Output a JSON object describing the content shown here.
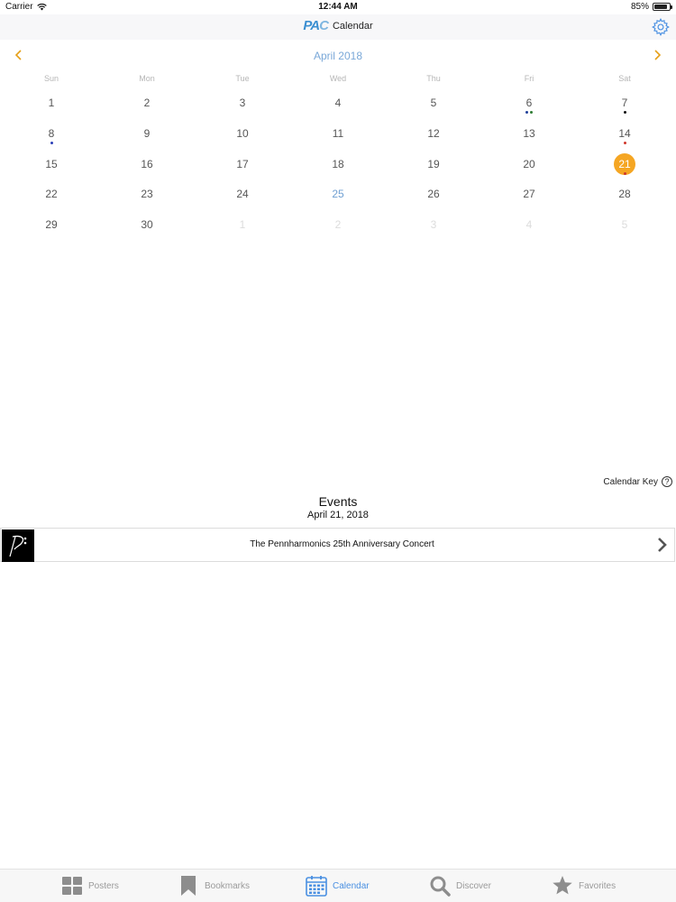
{
  "status_bar": {
    "carrier": "Carrier",
    "time": "12:44 AM",
    "battery": "85%",
    "battery_level": 0.85
  },
  "nav": {
    "title": "Calendar",
    "logo_a": "PA",
    "logo_b": "C"
  },
  "calendar": {
    "month": "April 2018",
    "weekdays": [
      "Sun",
      "Mon",
      "Tue",
      "Wed",
      "Thu",
      "Fri",
      "Sat"
    ],
    "days": [
      {
        "n": "1"
      },
      {
        "n": "2"
      },
      {
        "n": "3"
      },
      {
        "n": "4"
      },
      {
        "n": "5"
      },
      {
        "n": "6",
        "dots": [
          "#1f3f99",
          "#2f7d34"
        ]
      },
      {
        "n": "7",
        "dots": [
          "#111111"
        ]
      },
      {
        "n": "8",
        "dots": [
          "#2b3fb8"
        ]
      },
      {
        "n": "9"
      },
      {
        "n": "10"
      },
      {
        "n": "11"
      },
      {
        "n": "12"
      },
      {
        "n": "13"
      },
      {
        "n": "14",
        "dots": [
          "#d0372b"
        ]
      },
      {
        "n": "15"
      },
      {
        "n": "16"
      },
      {
        "n": "17"
      },
      {
        "n": "18"
      },
      {
        "n": "19"
      },
      {
        "n": "20"
      },
      {
        "n": "21",
        "state": "selected",
        "dots": [
          "#d0372b"
        ]
      },
      {
        "n": "22"
      },
      {
        "n": "23"
      },
      {
        "n": "24"
      },
      {
        "n": "25",
        "state": "today"
      },
      {
        "n": "26"
      },
      {
        "n": "27"
      },
      {
        "n": "28"
      },
      {
        "n": "29"
      },
      {
        "n": "30"
      },
      {
        "n": "1",
        "state": "other"
      },
      {
        "n": "2",
        "state": "other"
      },
      {
        "n": "3",
        "state": "other"
      },
      {
        "n": "4",
        "state": "other"
      },
      {
        "n": "5",
        "state": "other"
      }
    ]
  },
  "calendar_key": "Calendar Key",
  "events": {
    "title": "Events",
    "date": "April 21, 2018",
    "items": [
      {
        "title": "The Pennharmonics 25th Anniversary Concert"
      }
    ]
  },
  "tabs": [
    {
      "label": "Posters",
      "icon": "grid-icon"
    },
    {
      "label": "Bookmarks",
      "icon": "bookmark-icon"
    },
    {
      "label": "Calendar",
      "icon": "calendar-icon",
      "active": true
    },
    {
      "label": "Discover",
      "icon": "search-icon"
    },
    {
      "label": "Favorites",
      "icon": "star-icon"
    }
  ],
  "colors": {
    "accent": "#f5a623",
    "blue": "#4a90e2",
    "month_title": "#7aa8d8"
  }
}
